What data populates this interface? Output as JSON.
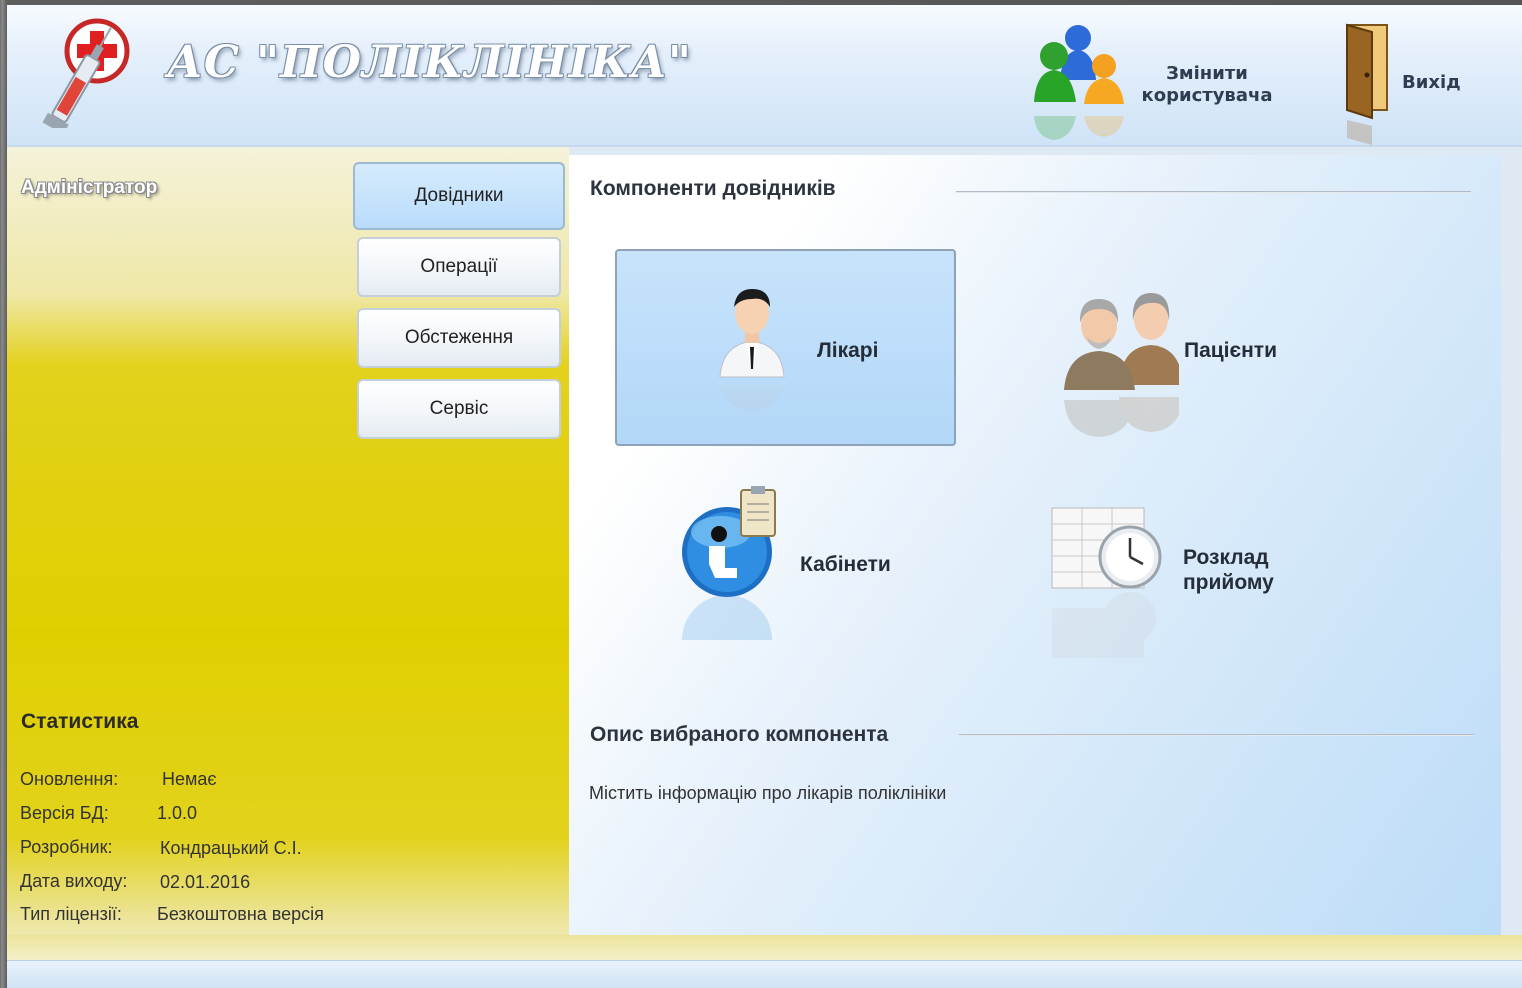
{
  "header": {
    "title": "АС \"ПОЛІКЛІНІКА\"",
    "change_user_label_1": "Змінити",
    "change_user_label_2": "користувача",
    "exit_label": "Вихід"
  },
  "sidebar": {
    "user_role": "Адміністратор",
    "nav": [
      {
        "label": "Довідники",
        "active": true
      },
      {
        "label": "Операції"
      },
      {
        "label": "Обстеження"
      },
      {
        "label": "Сервіс"
      }
    ],
    "stats": {
      "title": "Статистика",
      "rows": [
        {
          "label": "Оновлення:",
          "value": "Немає"
        },
        {
          "label": "Версія БД:",
          "value": "1.0.0"
        },
        {
          "label": "Розробник:",
          "value": "Кондрацький С.І."
        },
        {
          "label": "Дата виходу:",
          "value": "02.01.2016"
        },
        {
          "label": "Тип ліцензії:",
          "value": "Безкоштовна версія"
        }
      ]
    }
  },
  "main": {
    "components_title": "Компоненти довідників",
    "components": [
      {
        "label": "Лікарі",
        "icon": "doctor-icon",
        "selected": true
      },
      {
        "label": "Пацієнти",
        "icon": "patients-icon"
      },
      {
        "label": "Кабінети",
        "icon": "cabinet-icon"
      },
      {
        "label_1": "Розклад",
        "label_2": "прийому",
        "icon": "schedule-icon"
      }
    ],
    "description_title": "Опис вибраного компонента",
    "description": "Містить інформацію про лікарів поліклініки"
  },
  "colors": {
    "sidebar_yellow": "#e0cf00",
    "header_blue": "#cfe3f7",
    "selected_blue": "#b9dcfb"
  }
}
